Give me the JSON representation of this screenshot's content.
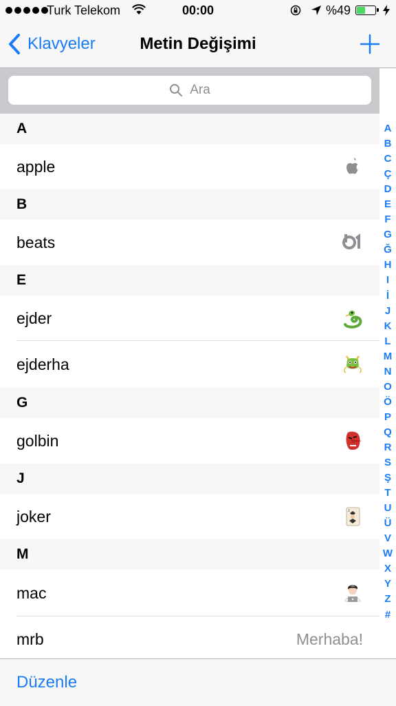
{
  "status_bar": {
    "carrier": "Turk Telekom",
    "time": "00:00",
    "battery_percent": "%49",
    "battery_level": 0.49,
    "battery_color": "#4cd964"
  },
  "nav": {
    "back_label": "Klavyeler",
    "title": "Metin Değişimi",
    "add_icon": "plus-icon",
    "accent_color": "#1a7cf6"
  },
  "search": {
    "placeholder": "Ara"
  },
  "sections": [
    {
      "letter": "A",
      "items": [
        {
          "phrase": "apple",
          "shortcut_icon": "apple-logo-icon"
        }
      ]
    },
    {
      "letter": "B",
      "items": [
        {
          "phrase": "beats",
          "shortcut_icon": "beats1-logo-icon"
        }
      ]
    },
    {
      "letter": "E",
      "items": [
        {
          "phrase": "ejder",
          "shortcut_icon": "dragon-emoji-icon"
        },
        {
          "phrase": "ejderha",
          "shortcut_icon": "dragon-face-emoji-icon"
        }
      ]
    },
    {
      "letter": "G",
      "items": [
        {
          "phrase": "golbin",
          "shortcut_icon": "japanese-goblin-emoji-icon"
        }
      ]
    },
    {
      "letter": "J",
      "items": [
        {
          "phrase": "joker",
          "shortcut_icon": "joker-card-emoji-icon"
        }
      ]
    },
    {
      "letter": "M",
      "items": [
        {
          "phrase": "mac",
          "shortcut_icon": "technologist-emoji-icon"
        },
        {
          "phrase": "mrb",
          "shortcut_text": "Merhaba!"
        }
      ]
    }
  ],
  "index_letters": [
    "A",
    "B",
    "C",
    "Ç",
    "D",
    "E",
    "F",
    "G",
    "Ğ",
    "H",
    "I",
    "İ",
    "J",
    "K",
    "L",
    "M",
    "N",
    "O",
    "Ö",
    "P",
    "Q",
    "R",
    "S",
    "Ş",
    "T",
    "U",
    "Ü",
    "V",
    "W",
    "X",
    "Y",
    "Z",
    "#"
  ],
  "toolbar": {
    "edit_label": "Düzenle"
  }
}
